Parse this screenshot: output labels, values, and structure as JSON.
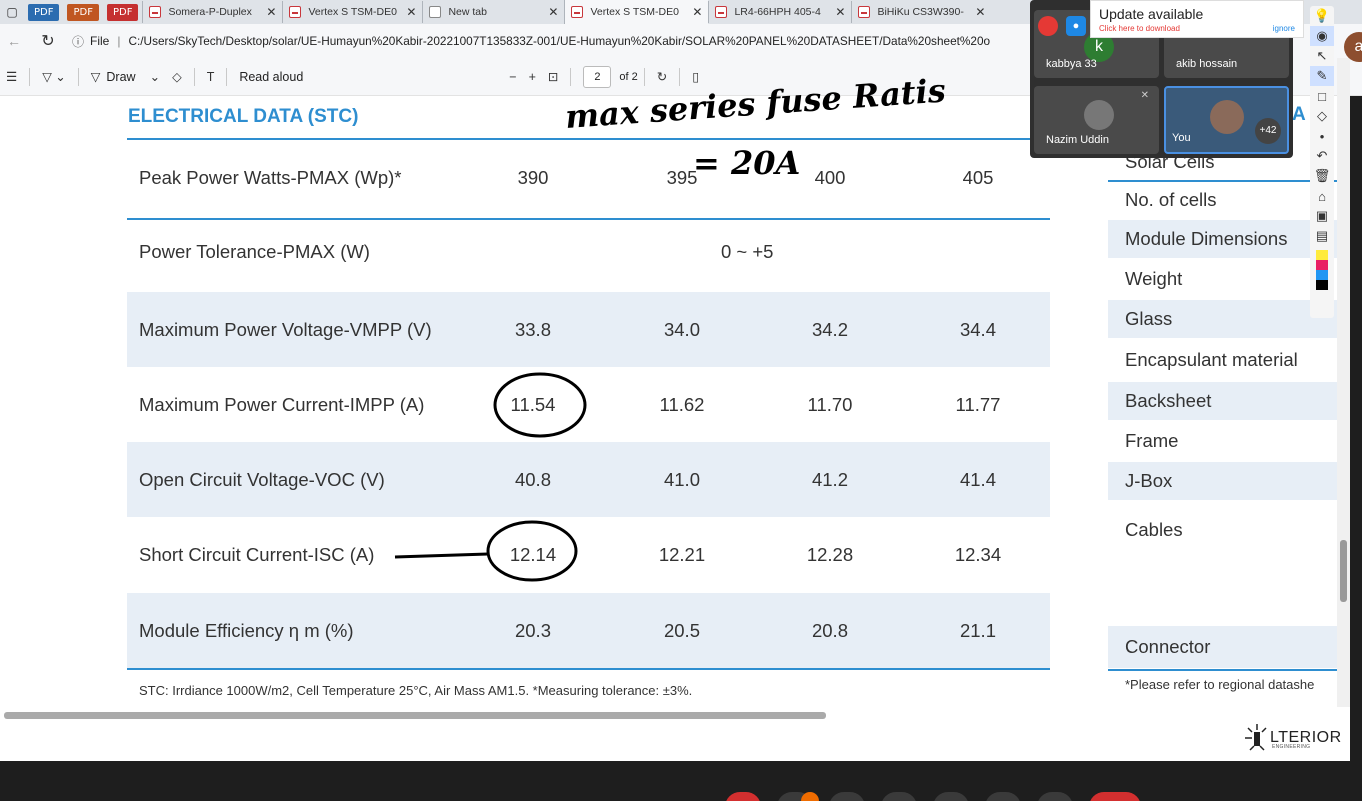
{
  "tabs": [
    {
      "kind": "pdf-badge",
      "label": "PDF",
      "color": "#2b6cb0"
    },
    {
      "kind": "pdf-badge",
      "label": "PDF",
      "color": "#c05621"
    },
    {
      "kind": "pdf-badge",
      "label": "PDF",
      "color": "#c53030"
    },
    {
      "kind": "tab",
      "label": "Somera-P-Duplex",
      "active": false
    },
    {
      "kind": "tab",
      "label": "Vertex S TSM-DE0",
      "active": false
    },
    {
      "kind": "tab",
      "label": "New tab",
      "active": false
    },
    {
      "kind": "tab",
      "label": "Vertex S TSM-DE0",
      "active": true
    },
    {
      "kind": "tab",
      "label": "LR4-66HPH 405-4",
      "active": false
    },
    {
      "kind": "tab",
      "label": "BiHiKu CS3W390-",
      "active": false
    }
  ],
  "address": {
    "label": "File",
    "url": "C:/Users/SkyTech/Desktop/solar/UE-Humayun%20Kabir-20221007T135833Z-001/UE-Humayun%20Kabir/SOLAR%20PANEL%20DATASHEET/Data%20sheet%20o"
  },
  "pdf_toolbar": {
    "draw_label": "Draw",
    "read_aloud_label": "Read aloud",
    "current_page": "2",
    "page_total": "of 2"
  },
  "datasheet": {
    "section_title": "ELECTRICAL DATA (STC)",
    "rows": [
      {
        "name": "Peak Power Watts-PMAX (Wp)*",
        "values": [
          "390",
          "395",
          "400",
          "405"
        ],
        "shaded": false
      },
      {
        "name": "Power Tolerance-PMAX (W)",
        "tolerance": "0 ~ +5",
        "shaded": false
      },
      {
        "name": "Maximum Power Voltage-VMPP (V)",
        "values": [
          "33.8",
          "34.0",
          "34.2",
          "34.4"
        ],
        "shaded": true
      },
      {
        "name": "Maximum Power Current-IMPP (A)",
        "values": [
          "11.54",
          "11.62",
          "11.70",
          "11.77"
        ],
        "shaded": false
      },
      {
        "name": "Open Circuit Voltage-VOC (V)",
        "values": [
          "40.8",
          "41.0",
          "41.2",
          "41.4"
        ],
        "shaded": true
      },
      {
        "name": "Short Circuit Current-ISC (A)",
        "values": [
          "12.14",
          "12.21",
          "12.28",
          "12.34"
        ],
        "shaded": false
      },
      {
        "name": "Module Efficiency η m (%)",
        "values": [
          "20.3",
          "20.5",
          "20.8",
          "21.1"
        ],
        "shaded": true
      }
    ],
    "footnote": "STC: Irrdiance 1000W/m2, Cell Temperature 25°C, Air Mass AM1.5.   *Measuring tolerance: ±3%."
  },
  "right_panel": {
    "title_fragment": "A",
    "items": [
      {
        "label": "Solar Cells",
        "shaded": false
      },
      {
        "label": "No. of cells",
        "shaded": false
      },
      {
        "label": "Module Dimensions",
        "shaded": true
      },
      {
        "label": "Weight",
        "shaded": false
      },
      {
        "label": "Glass",
        "shaded": true
      },
      {
        "label": "Encapsulant material",
        "shaded": false
      },
      {
        "label": "Backsheet",
        "shaded": true
      },
      {
        "label": "Frame",
        "shaded": false
      },
      {
        "label": "J-Box",
        "shaded": true
      },
      {
        "label": "Cables",
        "shaded": false
      },
      {
        "label": "Connector",
        "shaded": true
      }
    ],
    "footnote": "*Please refer to regional datashe"
  },
  "handwritten_note": {
    "line1": "max series fuse Ratis",
    "line2": "= 20A"
  },
  "meeting": {
    "participants": [
      {
        "name": "kabbya 33",
        "initial": "k",
        "color": "#2e7d32"
      },
      {
        "name": "akib hossain",
        "initial": "a",
        "color": "#8d4e2f"
      },
      {
        "name": "Nazim Uddin",
        "initial": "",
        "color": "#6d6d6d"
      },
      {
        "name": "You",
        "initial": "",
        "color": "#3a5a7a"
      }
    ],
    "more_count": "+42"
  },
  "update_popup": {
    "title": "Update available",
    "subtitle": "Click here to download",
    "ignore": "ignore"
  },
  "logo": {
    "text": "LTERIOR",
    "subtext": "ENGINEERING"
  }
}
